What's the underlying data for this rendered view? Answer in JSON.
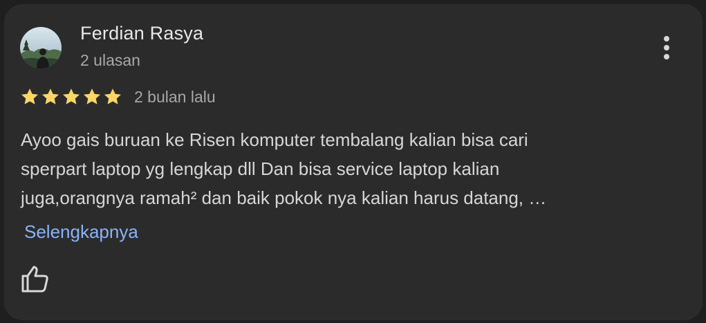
{
  "review": {
    "author_name": "Ferdian Rasya",
    "author_reviews": "2 ulasan",
    "rating": 5,
    "rating_max": 5,
    "time_ago": "2 bulan lalu",
    "text_lines": [
      "Ayoo gais buruan ke Risen komputer tembalang kalian bisa cari",
      "sperpart laptop yg lengkap dll Dan bisa service laptop kalian",
      "juga,orangnya ramah² dan baik pokok nya kalian harus datang, …"
    ],
    "more_label": "Selengkapnya"
  },
  "icons": {
    "menu": "more-vert-icon",
    "like": "thumb-up-icon",
    "star": "star-icon"
  },
  "colors": {
    "card_bg": "#2b2b2b",
    "page_bg": "#1f1f1f",
    "star": "#fdd663",
    "link": "#8ab4f8"
  }
}
